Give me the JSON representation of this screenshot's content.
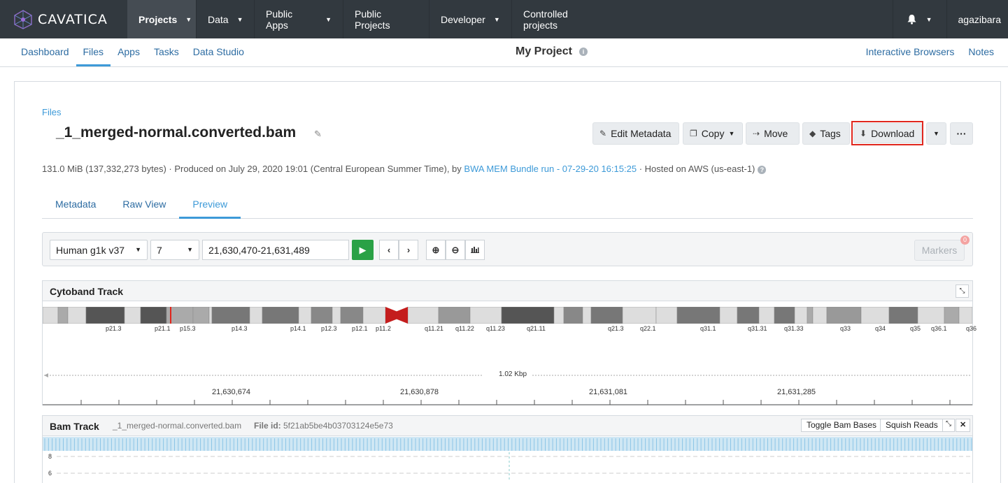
{
  "brand": {
    "name": "CAVATICA",
    "accent": "#3d9ad8",
    "nav_bg": "#32393f"
  },
  "topnav": {
    "items": [
      {
        "label": "Projects",
        "caret": true,
        "active": true
      },
      {
        "label": "Data",
        "caret": true
      },
      {
        "label": "Public Apps",
        "caret": true
      },
      {
        "label": "Public Projects",
        "caret": false
      },
      {
        "label": "Developer",
        "caret": true
      },
      {
        "label": "Controlled projects",
        "caret": false
      }
    ],
    "bell_icon": "bell-icon",
    "user": "agazibara"
  },
  "subnav": {
    "tabs": [
      "Dashboard",
      "Files",
      "Apps",
      "Tasks",
      "Data Studio"
    ],
    "active_tab": "Files",
    "project_title": "My Project",
    "right_links": [
      "Interactive Browsers",
      "Notes"
    ]
  },
  "file": {
    "breadcrumb": "Files",
    "title": "_1_merged-normal.converted.bam",
    "meta_prefix": "131.0 MiB (137,332,273 bytes) · Produced on July 29, 2020 19:01 (Central European Summer Time), by",
    "meta_link": "BWA MEM Bundle run - 07-29-20 16:15:25",
    "meta_suffix": "· Hosted on AWS (us-east-1)"
  },
  "actions": {
    "edit_metadata": "Edit Metadata",
    "copy": "Copy",
    "move": "Move",
    "tags": "Tags",
    "download": "Download",
    "more": "···"
  },
  "file_tabs": [
    "Metadata",
    "Raw View",
    "Preview"
  ],
  "active_file_tab": "Preview",
  "igv": {
    "genome": "Human g1k v37",
    "chromosome": "7",
    "locus": "21,630,470-21,631,489",
    "markers_label": "Markers",
    "markers_count": "0"
  },
  "cytoband": {
    "title": "Cytoband Track",
    "band_labels": [
      "p21.3",
      "p21.1",
      "p15.3",
      "p14.3",
      "p14.1",
      "p12.3",
      "p12.1",
      "p11.2",
      "q11.21",
      "q11.22",
      "q11.23",
      "q21.11",
      "q21.3",
      "q22.1",
      "q31.1",
      "q31.31",
      "q31.33",
      "q33",
      "q34",
      "q35",
      "q36.1",
      "q36"
    ],
    "span_label": "1.02 Kbp",
    "ruler_labels": [
      "21,630,674",
      "21,630,878",
      "21,631,081",
      "21,631,285"
    ]
  },
  "bam": {
    "title": "Bam Track",
    "file_name": "_1_merged-normal.converted.bam",
    "file_id_label": "File id:",
    "file_id": "5f21ab5be4b03703124e5e73",
    "toggle_label": "Toggle Bam Bases",
    "squish_label": "Squish Reads",
    "y_labels": [
      "8",
      "6"
    ]
  }
}
